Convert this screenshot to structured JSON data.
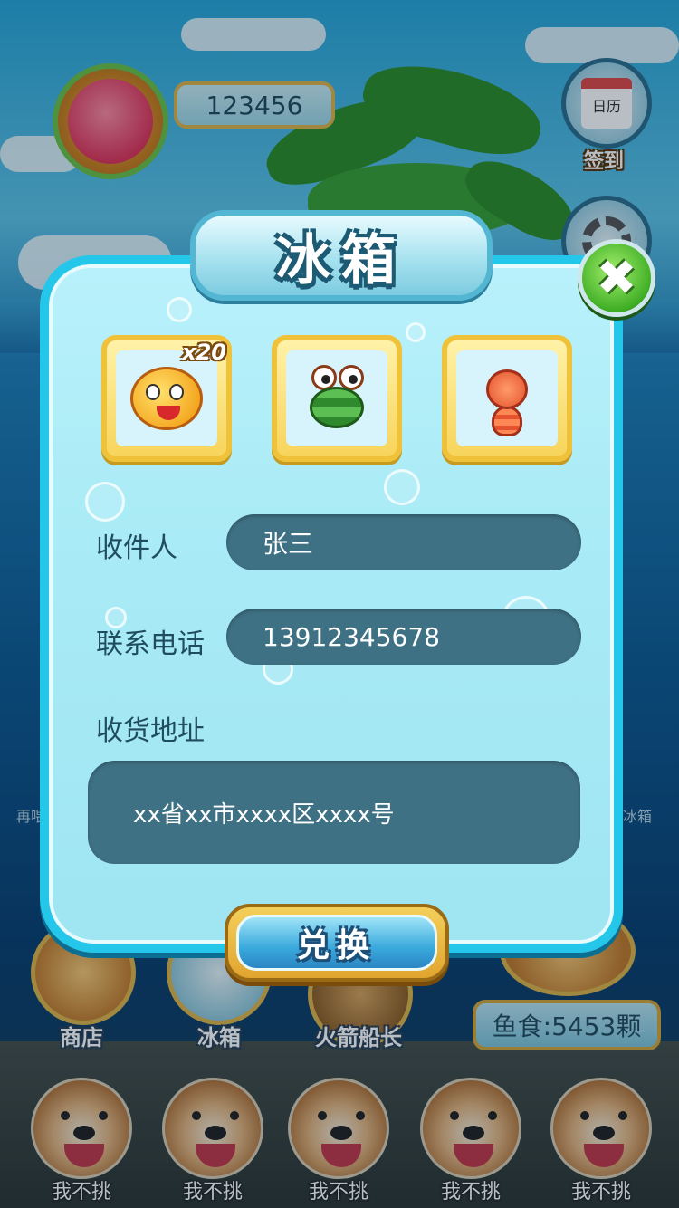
{
  "header": {
    "score": "123456",
    "calendar_icon_text": "日历",
    "checkin_label": "签到"
  },
  "dialog": {
    "title": "冰箱",
    "items": [
      {
        "name": "fish",
        "count": "x20"
      },
      {
        "name": "crab",
        "count": ""
      },
      {
        "name": "shrimp",
        "count": ""
      }
    ],
    "recipient_label": "收件人",
    "recipient_value": "张三",
    "phone_label": "联系电话",
    "phone_value": "13912345678",
    "address_label": "收货地址",
    "address_value": "xx省xx市xxxx区xxxx号",
    "exchange_label": "兑换"
  },
  "bottom_nav": {
    "shop_label": "商店",
    "fridge_label": "冰箱",
    "captain_label": "火箭船长",
    "fish_food": "鱼食:5453颗"
  },
  "side_text": {
    "left_faint": "再喂",
    "right_faint": "入冰箱"
  },
  "friends": [
    {
      "label": "我不挑"
    },
    {
      "label": "我不挑"
    },
    {
      "label": "我不挑"
    },
    {
      "label": "我不挑"
    },
    {
      "label": "我不挑"
    }
  ],
  "colors": {
    "dialog_border": "#24c7ea",
    "field_bg": "#3f7184",
    "close_green": "#3fae25",
    "button_gold": "#e0a52f"
  }
}
